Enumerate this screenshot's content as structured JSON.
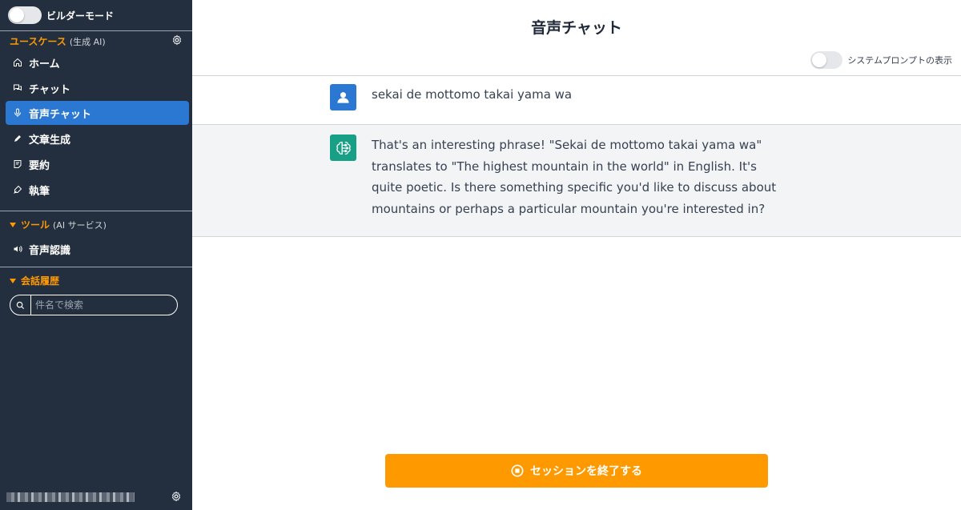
{
  "sidebar": {
    "builder_mode_label": "ビルダーモード",
    "usecase_section": {
      "title": "ユースケース",
      "subtitle": "(生成 AI)"
    },
    "nav_items": [
      {
        "label": "ホーム",
        "icon": "home-icon"
      },
      {
        "label": "チャット",
        "icon": "chat-icon"
      },
      {
        "label": "音声チャット",
        "icon": "microphone-icon",
        "active": true
      },
      {
        "label": "文章生成",
        "icon": "pencil-icon"
      },
      {
        "label": "要約",
        "icon": "summary-icon"
      },
      {
        "label": "執筆",
        "icon": "pen-icon"
      }
    ],
    "tools_section": {
      "title": "ツール",
      "subtitle": "(AI サービス)"
    },
    "tool_items": [
      {
        "label": "音声認識",
        "icon": "speaker-icon"
      }
    ],
    "history_section": {
      "title": "会話履歴"
    },
    "search": {
      "placeholder": "件名で検索",
      "value": ""
    }
  },
  "main": {
    "title": "音声チャット",
    "system_prompt_toggle_label": "システムプロンプトの表示",
    "messages": [
      {
        "role": "user",
        "text": "sekai de mottomo takai yama wa"
      },
      {
        "role": "assistant",
        "text": "That's an interesting phrase! \"Sekai de mottomo takai yama wa\" translates to \"The highest mountain in the world\" in English. It's quite poetic. Is there something specific you'd like to discuss about mountains or perhaps a particular mountain you're interested in?"
      }
    ],
    "end_session_label": "セッションを終了する"
  },
  "colors": {
    "sidebar_bg": "#232f3e",
    "accent_orange": "#ff9900",
    "active_blue": "#2b78d2",
    "bot_avatar_green": "#17a085"
  }
}
